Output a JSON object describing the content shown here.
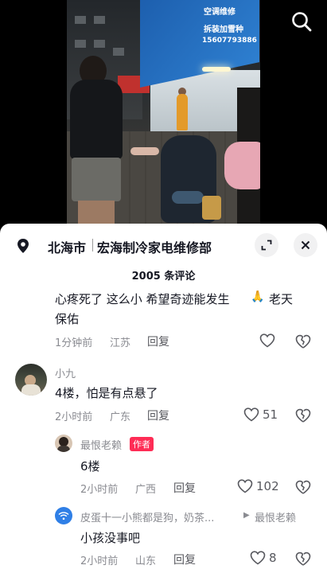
{
  "video": {
    "sign_line1": "空调维修",
    "sign_line2": "拆装加雪种",
    "sign_phone": "15607793886"
  },
  "location": {
    "city": "北海市",
    "shop": "宏海制冷家电维修部"
  },
  "comments_header": {
    "count_label": "2005 条评论"
  },
  "comments": [
    {
      "text_line1": "心疼死了 这么小 希望奇迹能发生",
      "text_line1_tail": "老天",
      "text_line2": "保佑",
      "time": "1分钟前",
      "region": "江苏",
      "reply_label": "回复",
      "likes": ""
    },
    {
      "user": "小九",
      "text": "4楼，怕是有点悬了",
      "time": "2小时前",
      "region": "广东",
      "reply_label": "回复",
      "likes": "51"
    },
    {
      "user": "最恨老赖",
      "badge": "作者",
      "text": "6楼",
      "time": "2小时前",
      "region": "广西",
      "reply_label": "回复",
      "likes": "102"
    },
    {
      "user": "皮蛋十一小熊都是狗，奶茶...",
      "reply_to": "最恨老赖",
      "text": "小孩没事吧",
      "time": "2小时前",
      "region": "山东",
      "reply_label": "回复",
      "likes": "8"
    }
  ],
  "colors": {
    "accent": "#fe2c55",
    "text": "#161823",
    "meta": "#8a8b91",
    "wifi_avatar": "#2f7fe6"
  }
}
